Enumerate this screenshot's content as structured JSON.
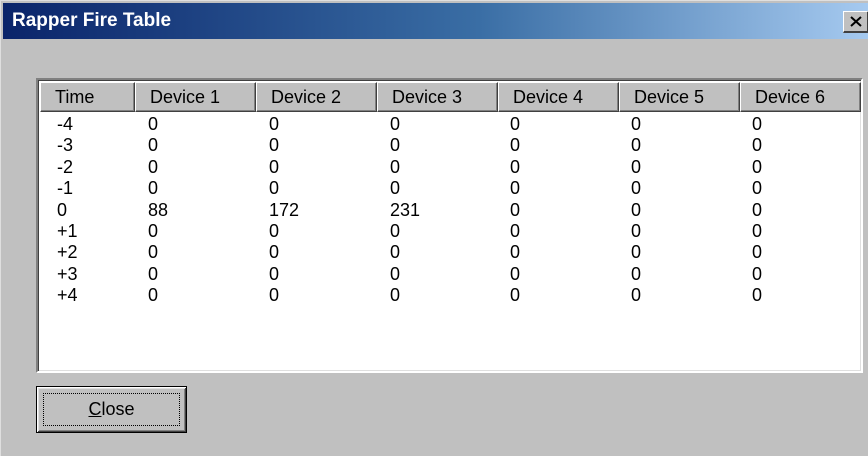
{
  "window": {
    "title": "Rapper Fire Table",
    "close_icon": "close-icon"
  },
  "table": {
    "columns": [
      "Time",
      "Device 1",
      "Device 2",
      "Device 3",
      "Device 4",
      "Device 5",
      "Device 6"
    ],
    "rows": [
      [
        "-4",
        "0",
        "0",
        "0",
        "0",
        "0",
        "0"
      ],
      [
        "-3",
        "0",
        "0",
        "0",
        "0",
        "0",
        "0"
      ],
      [
        "-2",
        "0",
        "0",
        "0",
        "0",
        "0",
        "0"
      ],
      [
        "-1",
        "0",
        "0",
        "0",
        "0",
        "0",
        "0"
      ],
      [
        "0",
        "88",
        "172",
        "231",
        "0",
        "0",
        "0"
      ],
      [
        "+1",
        "0",
        "0",
        "0",
        "0",
        "0",
        "0"
      ],
      [
        "+2",
        "0",
        "0",
        "0",
        "0",
        "0",
        "0"
      ],
      [
        "+3",
        "0",
        "0",
        "0",
        "0",
        "0",
        "0"
      ],
      [
        "+4",
        "0",
        "0",
        "0",
        "0",
        "0",
        "0"
      ]
    ]
  },
  "buttons": {
    "close_accel": "C",
    "close_rest": "lose"
  }
}
